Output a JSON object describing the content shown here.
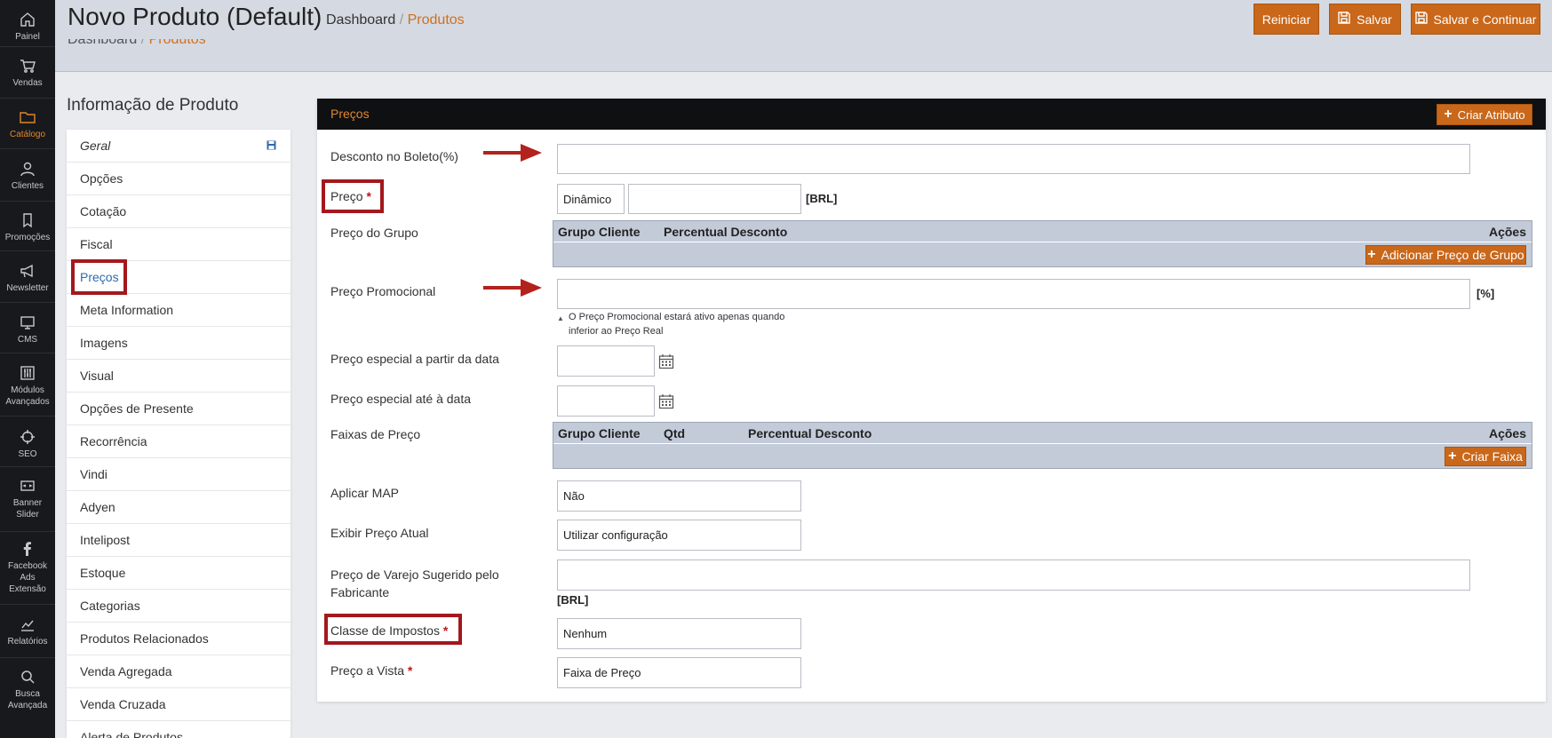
{
  "rail": [
    {
      "label": "Painel",
      "icon": "home-icon"
    },
    {
      "label": "Vendas",
      "icon": "cart-icon"
    },
    {
      "label": "Catálogo",
      "icon": "folder-icon",
      "active": true
    },
    {
      "label": "Clientes",
      "icon": "user-icon"
    },
    {
      "label": "Promoções",
      "icon": "tag-icon"
    },
    {
      "label": "Newsletter",
      "icon": "megaphone-icon"
    },
    {
      "label": "CMS",
      "icon": "monitor-icon"
    },
    {
      "label": "Módulos\nAvançados",
      "icon": "sliders-icon"
    },
    {
      "label": "SEO",
      "icon": "crosshair-icon"
    },
    {
      "label": "Banner\nSlider",
      "icon": "banner-icon"
    },
    {
      "label": "Facebook\nAds\nExtensão",
      "icon": "facebook-icon"
    },
    {
      "label": "Relatórios",
      "icon": "chart-icon"
    },
    {
      "label": "Busca\nAvançada",
      "icon": "search-icon"
    }
  ],
  "header": {
    "title": "Novo Produto (Default)",
    "breadcrumb_home": "Dashboard",
    "breadcrumb_sep": " / ",
    "breadcrumb_current": "Produtos",
    "reset_label": "Reiniciar",
    "save_label": "Salvar",
    "save_continue_label": "Salvar e Continuar"
  },
  "nav": {
    "heading": "Informação de Produto",
    "items": [
      "Geral",
      "Opções",
      "Cotação",
      "Fiscal",
      "Preços",
      "Meta Information",
      "Imagens",
      "Visual",
      "Opções de Presente",
      "Recorrência",
      "Vindi",
      "Adyen",
      "Intelipost",
      "Estoque",
      "Categorias",
      "Produtos Relacionados",
      "Venda Agregada",
      "Venda Cruzada",
      "Alerta de Produtos"
    ]
  },
  "panel": {
    "title": "Preços",
    "create_attribute": "Criar Atributo",
    "boleto_label": "Desconto no Boleto(%)",
    "boleto_value": "",
    "price_label": "Preço",
    "price_type_value": "Dinâmico",
    "price_value": "",
    "currency": "[BRL]",
    "group_price_label": "Preço do Grupo",
    "group_col_customer": "Grupo Cliente",
    "group_col_discount": "Percentual Desconto",
    "group_col_actions": "Ações",
    "add_group_price": "Adicionar Preço de Grupo",
    "promo_label": "Preço Promocional",
    "promo_value": "",
    "percent": "[%]",
    "promo_note_line1": "O Preço Promocional estará ativo apenas quando",
    "promo_note_line2": "inferior ao Preço Real",
    "special_from_label": "Preço especial a partir da data",
    "special_from_value": "",
    "special_to_label": "Preço especial até à data",
    "special_to_value": "",
    "tiers_label": "Faixas de Preço",
    "tier_col_customer": "Grupo Cliente",
    "tier_col_qty": "Qtd",
    "tier_col_discount": "Percentual Desconto",
    "tier_col_actions": "Ações",
    "create_tier": "Criar Faixa",
    "map_label": "Aplicar MAP",
    "map_value": "Não",
    "show_price_label": "Exibir Preço Atual",
    "show_price_value": "Utilizar configuração",
    "msrp_label_line1": "Preço de Varejo Sugerido pelo",
    "msrp_label_line2": "Fabricante",
    "msrp_value": "",
    "tax_label": "Classe de Impostos",
    "tax_value": "Nenhum",
    "cash_label": "Preço a Vista",
    "cash_value": "Faixa de Preço"
  },
  "colors": {
    "accent": "#c9671a",
    "highlight": "#a3181d",
    "rail": "#17191c"
  }
}
